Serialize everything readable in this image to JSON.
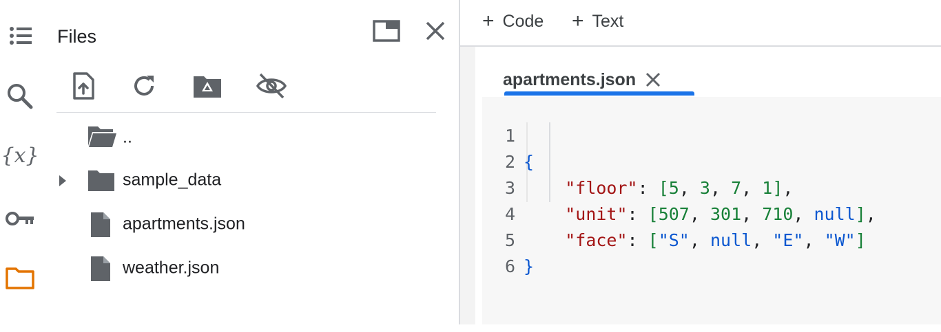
{
  "sidebar": {
    "icons": [
      "table-of-contents-icon",
      "search-icon",
      "variables-icon",
      "secrets-key-icon",
      "files-folder-icon"
    ],
    "variables_glyph": "{x}",
    "active": "files-folder-icon"
  },
  "files_panel": {
    "title": "Files",
    "toolbar_icons": [
      "upload-icon",
      "refresh-icon",
      "mount-drive-icon",
      "hide-hidden-files-icon"
    ],
    "tree": [
      {
        "label": "..",
        "type": "parent-folder",
        "expandable": false
      },
      {
        "label": "sample_data",
        "type": "folder",
        "expandable": true
      },
      {
        "label": "apartments.json",
        "type": "file",
        "expandable": false
      },
      {
        "label": "weather.json",
        "type": "file",
        "expandable": false
      }
    ]
  },
  "main_toolbar": {
    "code_label": "Code",
    "text_label": "Text",
    "plus": "+"
  },
  "editor": {
    "tab_label": "apartments.json",
    "lines": [
      {
        "n": "1",
        "text": "{"
      },
      {
        "n": "2",
        "text": "    \"floor\": [5, 3, 7, 1],"
      },
      {
        "n": "3",
        "text": "    \"unit\": [507, 301, 710, null],"
      },
      {
        "n": "4",
        "text": "    \"face\": [\"S\", null, \"E\", \"W\"]"
      },
      {
        "n": "5",
        "text": "}"
      },
      {
        "n": "6",
        "text": ""
      }
    ]
  },
  "colors": {
    "accent": "#1a73e8",
    "folder_active": "#e37400",
    "key": "#a31515",
    "number": "#188038",
    "keyword": "#0b57d0"
  }
}
